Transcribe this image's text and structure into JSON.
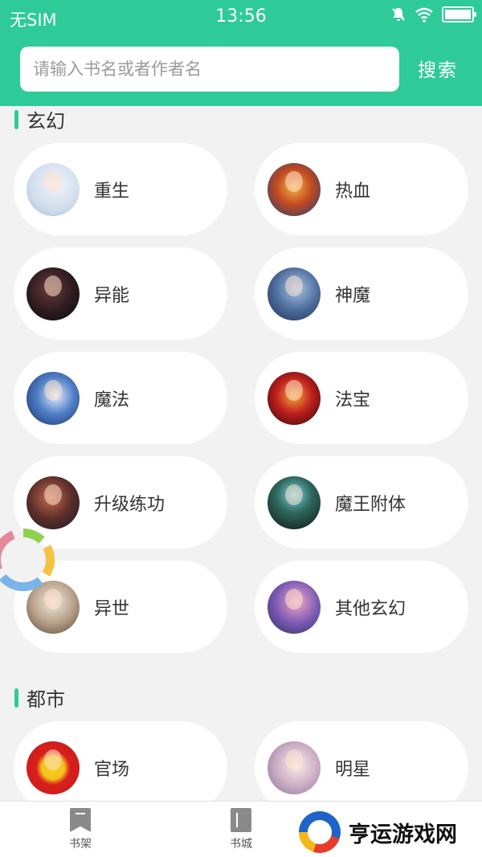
{
  "status_bar": {
    "carrier": "无SIM",
    "time": "13:56"
  },
  "search": {
    "placeholder": "请输入书名或者作者名",
    "button_label": "搜索"
  },
  "sections": [
    {
      "title": "玄幻",
      "items": [
        {
          "label": "重生",
          "icon": "avatar-image"
        },
        {
          "label": "热血",
          "icon": "avatar-image"
        },
        {
          "label": "异能",
          "icon": "avatar-image"
        },
        {
          "label": "神魔",
          "icon": "avatar-image"
        },
        {
          "label": "魔法",
          "icon": "avatar-image"
        },
        {
          "label": "法宝",
          "icon": "avatar-image"
        },
        {
          "label": "升级练功",
          "icon": "avatar-image"
        },
        {
          "label": "魔王附体",
          "icon": "avatar-image"
        },
        {
          "label": "异世",
          "icon": "avatar-image"
        },
        {
          "label": "其他玄幻",
          "icon": "avatar-image"
        }
      ]
    },
    {
      "title": "都市",
      "items": [
        {
          "label": "官场",
          "icon": "avatar-image"
        },
        {
          "label": "明星",
          "icon": "avatar-image"
        }
      ]
    }
  ],
  "tabbar": {
    "tabs": [
      {
        "label": "书架",
        "icon": "bookmark-icon"
      },
      {
        "label": "书城",
        "icon": "book-icon"
      }
    ]
  },
  "watermark": {
    "text": "亨运游戏网"
  },
  "colors": {
    "accent": "#2ecb98",
    "background": "#f2f2f2"
  }
}
